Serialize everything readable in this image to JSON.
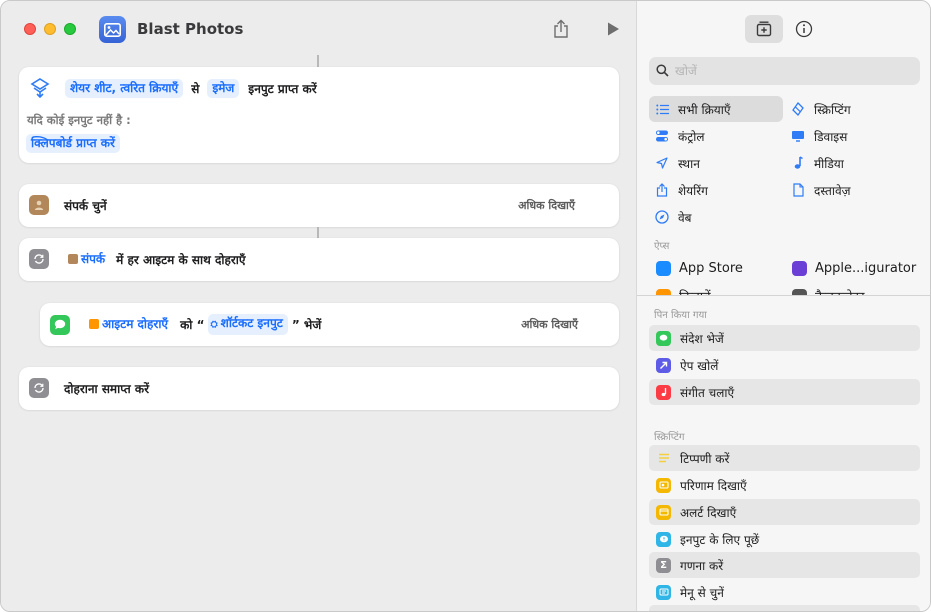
{
  "window": {
    "title": "Blast Photos"
  },
  "editor": {
    "receive_action": {
      "source_token": "शेयर शीट, त्वरित क्रियाएँ",
      "word_from": "से",
      "type_token": "इमेज",
      "label": "इनपुट प्राप्त करें",
      "if_no_input": "यदि कोई इनपुट नहीं है :",
      "fallback_token": "क्लिपबोर्ड प्राप्त करें"
    },
    "choose_contact": {
      "label": "संपर्क चुनें",
      "more": "अधिक दिखाएँ"
    },
    "repeat": {
      "token": "संपर्क",
      "label": "में हर आइटम के साथ दोहराएँ"
    },
    "send_message": {
      "item_token": "आइटम दोहराएँ",
      "word_to": "को “",
      "input_token": "शॉर्टकट इनपुट",
      "label": "” भेजें",
      "more": "अधिक दिखाएँ"
    },
    "end_repeat": {
      "label": "दोहराना समाप्त करें"
    }
  },
  "sidebar": {
    "search_placeholder": "खोजें",
    "categories": [
      {
        "label": "सभी क्रियाएँ",
        "icon": "list-icon"
      },
      {
        "label": "स्क्रिप्टिंग",
        "icon": "scripting-icon"
      },
      {
        "label": "कंट्रोल",
        "icon": "toggle-icon"
      },
      {
        "label": "डिवाइस",
        "icon": "display-icon"
      },
      {
        "label": "स्थान",
        "icon": "location-arrow-icon"
      },
      {
        "label": "मीडिया",
        "icon": "music-note-icon"
      },
      {
        "label": "शेयरिंग",
        "icon": "share-icon"
      },
      {
        "label": "दस्तावेज़",
        "icon": "document-icon"
      },
      {
        "label": "वेब",
        "icon": "compass-icon"
      }
    ],
    "apps_label": "ऐप्स",
    "apps": [
      {
        "label": "App Store",
        "color": "#1a8cff"
      },
      {
        "label": "Apple...igurator",
        "color": "#6b3fd6"
      },
      {
        "label": "किताबें",
        "color": "#ff9500"
      },
      {
        "label": "कैलकुलेटर",
        "color": "#555555"
      }
    ],
    "pinned_label": "पिन किया गया",
    "pinned": [
      {
        "label": "संदेश भेजें",
        "color": "#34c759"
      },
      {
        "label": "ऐप खोलें",
        "color": "#5e5ce6"
      },
      {
        "label": "संगीत चलाएँ",
        "color": "#fc3c44"
      }
    ],
    "scripting_label": "स्क्रिप्टिंग",
    "scripting": [
      {
        "label": "टिप्पणी करें",
        "color": "#f4d03f"
      },
      {
        "label": "परिणाम दिखाएँ",
        "color": "#f5b800"
      },
      {
        "label": "अलर्ट दिखाएँ",
        "color": "#f5b800"
      },
      {
        "label": "इनपुट के लिए पूछें",
        "color": "#2fb5e6"
      },
      {
        "label": "गणना करें",
        "color": "#8e8e93"
      },
      {
        "label": "मेनू से चुनें",
        "color": "#2fb5e6"
      }
    ]
  }
}
